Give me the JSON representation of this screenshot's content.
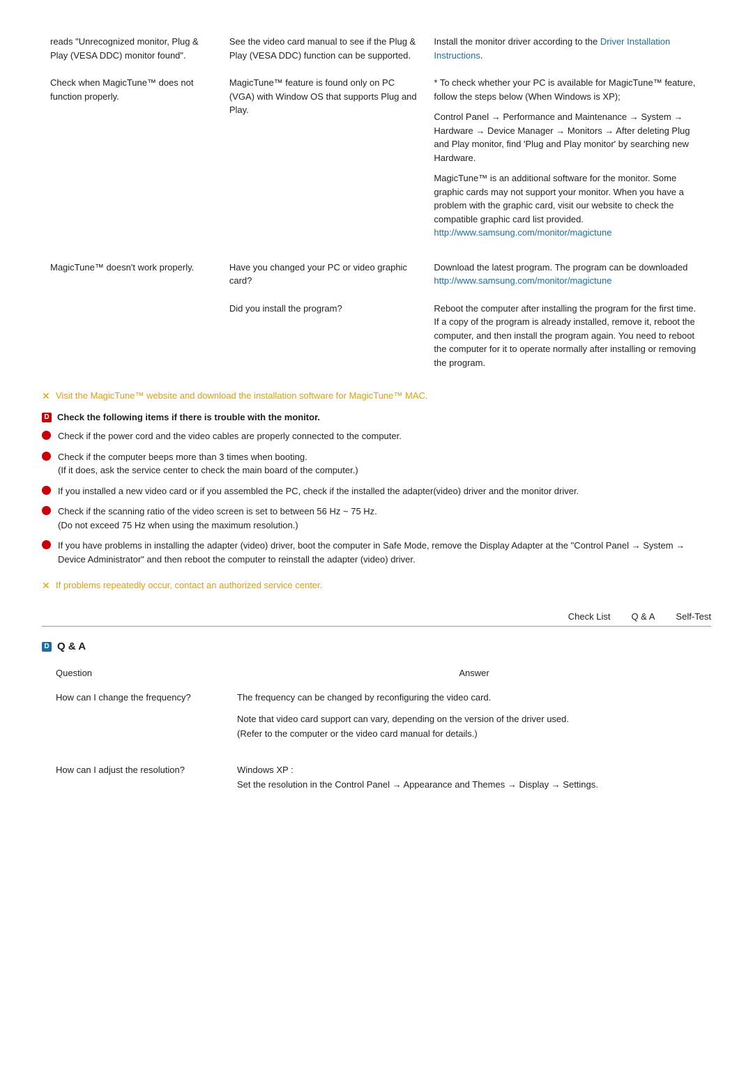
{
  "trouble_table": {
    "rows": [
      {
        "symptom": "reads \"Unrecognized monitor, Plug & Play (VESA DDC) monitor found\".",
        "cause": "See the video card manual to see if the Plug & Play (VESA DDC) function can be supported.",
        "solution": "Install the monitor driver according to the Driver Installation Instructions.",
        "solution_link_text": "Driver Installation Instructions",
        "solution_link_url": "#"
      },
      {
        "symptom": "Check when MagicTune™ does not function properly.",
        "cause": "MagicTune™ feature is found only on PC (VGA) with Window OS that supports Plug and Play.",
        "solution_parts": [
          "* To check whether your PC is available for MagicTune™ feature, follow the steps below (When Windows is XP);",
          "Control Panel → Performance and Maintenance → System → Hardware → Device Manager → Monitors → After deleting Plug and Play monitor, find 'Plug and Play monitor' by searching new Hardware.",
          "MagicTune™ is an additional software for the monitor. Some graphic cards may not support your monitor. When you have a problem with the graphic card, visit our website to check the compatible graphic card list provided.",
          "http://www.samsung.com/monitor/magictune"
        ],
        "solution_link_text": "http://www.samsung.com/monitor/magictune",
        "solution_link_url": "#"
      },
      {
        "symptom": "MagicTune™ doesn't work properly.",
        "cause_parts": [
          "Have you changed your PC or video graphic card?",
          "Did you install the program?"
        ],
        "solution_parts2": [
          "Download the latest program. The program can be downloaded http://www.samsung.com/monitor/magictune",
          "Reboot the computer after installing the program for the first time. If a copy of the program is already installed, remove it, reboot the computer, and then install the program again. You need to reboot the computer for it to operate normally after installing or removing the program."
        ],
        "dl_link_text": "http://www.samsung.com/monitor/magictune",
        "dl_link_url": "#"
      }
    ]
  },
  "note_magictune": "Visit the MagicTune™ website and download the installation software for MagicTune™ MAC.",
  "check_header": "Check the following items if there is trouble with the monitor.",
  "checklist": [
    "Check if the power cord and the video cables are properly connected to the computer.",
    "Check if the computer beeps more than 3 times when booting.\n(If it does, ask the service center to check the main board of the computer.)",
    "If you installed a new video card or if you assembled the PC, check if the installed the adapter(video) driver and the monitor driver.",
    "Check if the scanning ratio of the video screen is set to between 56 Hz ~ 75 Hz.\n(Do not exceed 75 Hz when using the maximum resolution.)",
    "If you have problems in installing the adapter (video) driver, boot the computer in Safe Mode, remove the Display Adapter at the \"Control Panel → System → Device Administrator\" and then reboot the computer to reinstall the adapter (video) driver."
  ],
  "note_problems": "If problems repeatedly occur, contact an authorized service center.",
  "nav_tabs": [
    "Check List",
    "Q & A",
    "Self-Test"
  ],
  "qa_section": {
    "title": "Q & A",
    "columns": [
      "Question",
      "Answer"
    ],
    "rows": [
      {
        "question": "How can I change the frequency?",
        "answers": [
          "The frequency can be changed by reconfiguring the video card.",
          "Note that video card support can vary, depending on the version of the driver used.\n(Refer to the computer or the video card manual for details.)"
        ]
      },
      {
        "question": "How can I adjust the resolution?",
        "answers": [
          "Windows XP :\nSet the resolution in the Control Panel → Appearance and Themes → Display → Settings."
        ]
      }
    ]
  }
}
